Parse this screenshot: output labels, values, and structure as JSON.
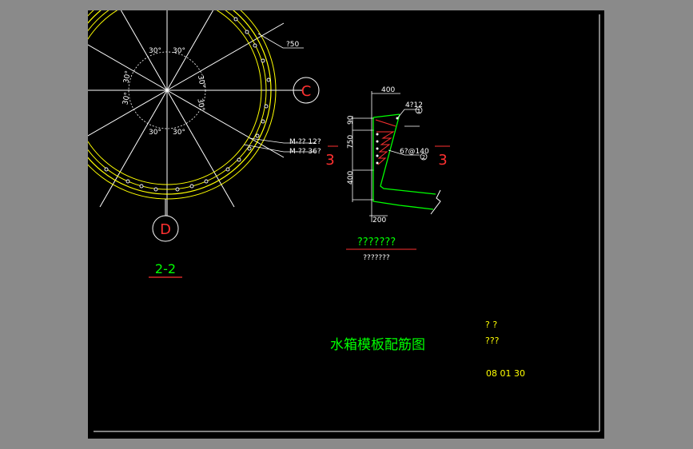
{
  "sheet": {
    "background": "#000000",
    "frame_color": "#ffffff"
  },
  "plan": {
    "angles": [
      "30°",
      "30°",
      "30°",
      "30°",
      "30°",
      "30°",
      "30°",
      "30°"
    ],
    "note_top": "?50",
    "note_bolt_1": "M-?? 12?",
    "note_bolt_2": "M-?? 36?",
    "axis_c": "C",
    "axis_d": "D",
    "section_title": "2-2",
    "colors": {
      "lines": "#ffffff",
      "rings": "#ffff00",
      "axis_bubble": "#ff0000",
      "section_title": "#00ff00"
    }
  },
  "section": {
    "dim_top": "400",
    "dim_90": "90",
    "dim_750": "750",
    "dim_400": "400",
    "dim_bottom": "200",
    "rebar_1": "4?12",
    "rebar_1_tag": "1",
    "rebar_2": "6?@140",
    "rebar_2_tag": "2",
    "cut_left": "3",
    "cut_right": "3",
    "caption_main": "???????",
    "caption_sub": "???????"
  },
  "title_block": {
    "drawing_title": "水箱模板配筋图",
    "field_1": "? ?",
    "field_2": "???",
    "date": "08 01 30"
  }
}
